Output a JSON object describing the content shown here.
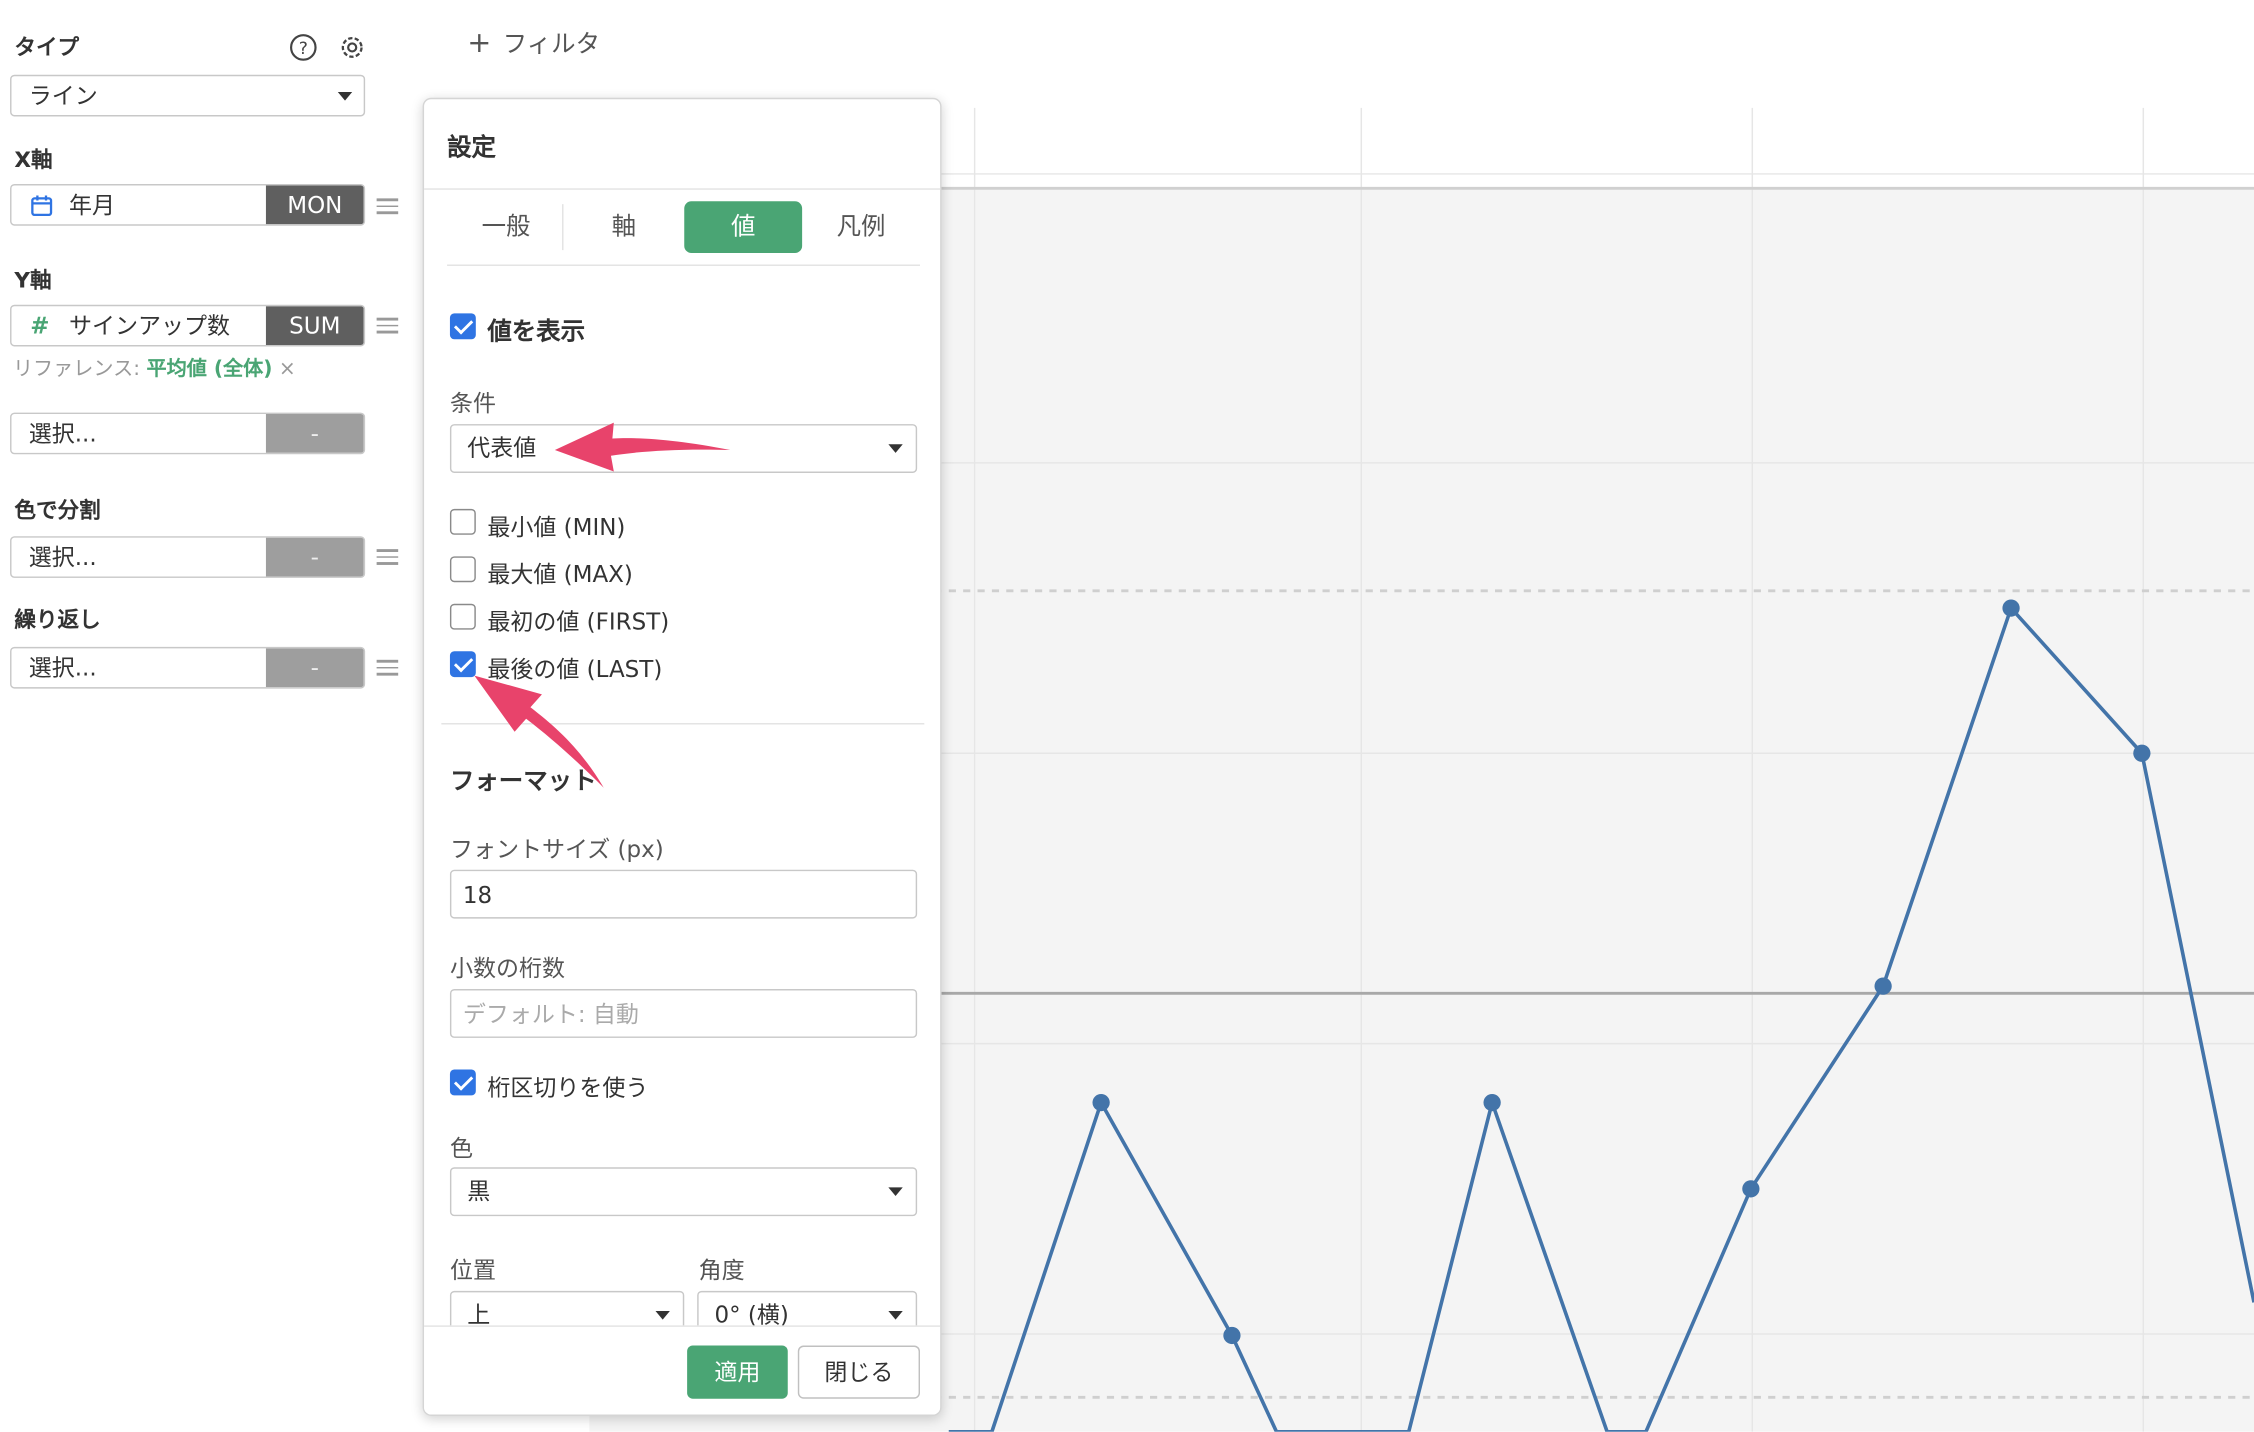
{
  "sidebar": {
    "type_label": "タイプ",
    "type_value": "ライン",
    "x_label": "X軸",
    "x_field": "年月",
    "x_agg": "MON",
    "y_label": "Y軸",
    "y_field": "サインアップ数",
    "y_agg": "SUM",
    "reference_prefix": "リファレンス: ",
    "reference_value": "平均値 (全体)",
    "reference_remove": "×",
    "extra_select": "選択...",
    "extra_btn": "-",
    "color_label": "色で分割",
    "color_select": "選択...",
    "color_btn": "-",
    "repeat_label": "繰り返し",
    "repeat_select": "選択...",
    "repeat_btn": "-"
  },
  "filter": {
    "label": "フィルタ"
  },
  "modal": {
    "title": "設定",
    "tabs": [
      "一般",
      "軸",
      "値",
      "凡例"
    ],
    "active_tab": "値",
    "show_values_label": "値を表示",
    "show_values_checked": true,
    "condition_label": "条件",
    "condition_value": "代表値",
    "options": [
      {
        "label": "最小値 (MIN)",
        "checked": false
      },
      {
        "label": "最大値 (MAX)",
        "checked": false
      },
      {
        "label": "最初の値 (FIRST)",
        "checked": false
      },
      {
        "label": "最後の値 (LAST)",
        "checked": true
      }
    ],
    "format_label": "フォーマット",
    "font_size_label": "フォントサイズ (px)",
    "font_size_value": "18",
    "decimals_label": "小数の桁数",
    "decimals_placeholder": "デフォルト: 自動",
    "separator_label": "桁区切りを使う",
    "separator_checked": true,
    "color_label": "色",
    "color_value": "黒",
    "position_label": "位置",
    "position_value": "上",
    "angle_label": "角度",
    "angle_value": "0° (横)",
    "apply_label": "適用",
    "close_label": "閉じる"
  },
  "colors": {
    "accent_green": "#4aa574",
    "line_blue": "#4374a9",
    "checkbox_blue": "#2f74e3",
    "annotation_pink": "#e8436b"
  }
}
